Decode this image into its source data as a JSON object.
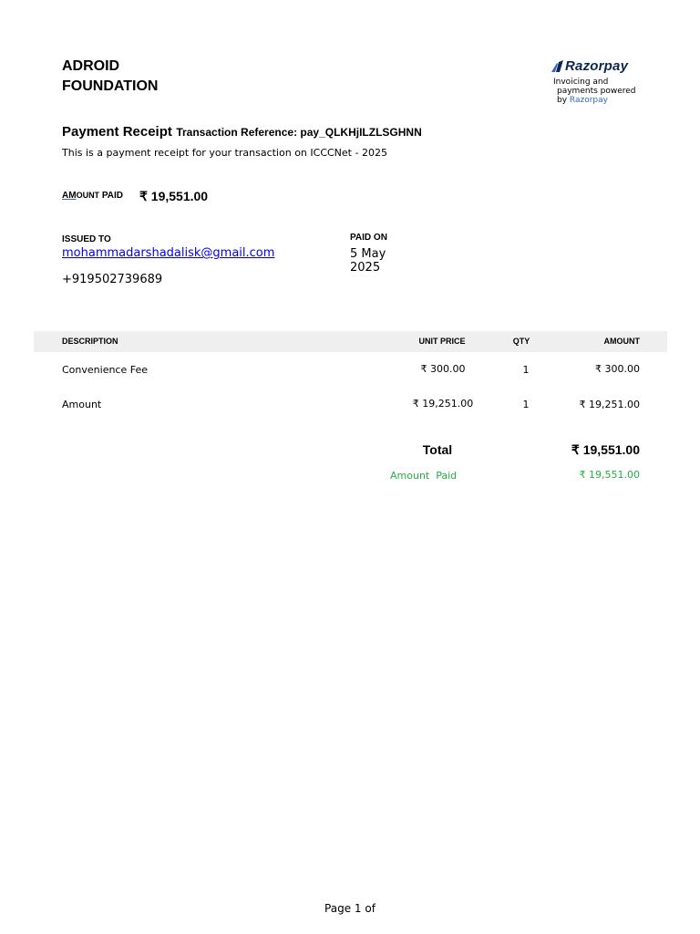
{
  "org": {
    "line1": "ADROID",
    "line2": "FOUNDATION"
  },
  "brand": {
    "logo_text": "Razorpay",
    "powered_line1": "Invoicing and",
    "powered_line2": "payments  powered",
    "powered_by": "by",
    "powered_name": "Razorpay",
    "color": "#0c2651",
    "accent": "#3367c9"
  },
  "receipt": {
    "title": "Payment Receipt",
    "reference": "Transaction Reference: pay_QLKHjILZLSGHNN",
    "description": "This is a payment receipt for your transaction on ICCCNet - 2025",
    "amount_label_prefix": "AM",
    "amount_label_rest": "OUNT",
    "amount_label_paid": "PAID",
    "amount_value": "₹ 19,551.00"
  },
  "issued": {
    "label": "ISSUED TO",
    "email": "mohammadarshadalisk@gmail.com",
    "phone": "+919502739689"
  },
  "paid_on": {
    "label": "PAID ON",
    "date": "5 May 2025"
  },
  "table": {
    "headers": {
      "description": "DESCRIPTION",
      "unit_price": "UNIT PRICE",
      "qty": "QTY",
      "amount": "AMOUNT"
    },
    "rows": [
      {
        "description": "Convenience Fee",
        "unit_price": "₹ 300.00",
        "qty": "1",
        "amount": "₹ 300.00"
      },
      {
        "description": "Amount",
        "unit_price": "₹ 19,251.00",
        "qty": "1",
        "amount": "₹ 19,251.00"
      }
    ],
    "header_bg": "#efefef"
  },
  "totals": {
    "total_label": "Total",
    "total_value": "₹ 19,551.00",
    "amount_paid_label": "Amount  Paid",
    "amount_paid_value": "₹ 19,551.00",
    "paid_color": "#21b142"
  },
  "footer": {
    "page": "Page 1 of"
  }
}
